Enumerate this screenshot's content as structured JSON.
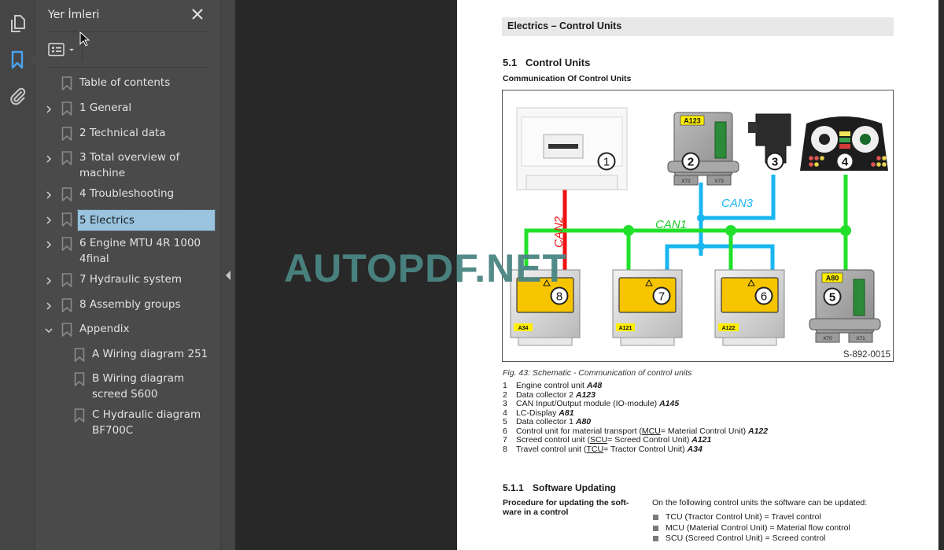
{
  "rail": {
    "icons": [
      "pages-icon",
      "bookmark-icon",
      "attachment-icon"
    ],
    "active_color": "#4aa3f0"
  },
  "panel": {
    "title": "Yer İmleri",
    "options_icon": "list-options-icon",
    "bookmarks": [
      {
        "label": "Table of contents",
        "expandable": false,
        "level": 0
      },
      {
        "label": "1 General",
        "expandable": true,
        "level": 0
      },
      {
        "label": "2 Technical data",
        "expandable": false,
        "level": 0
      },
      {
        "label_lines": [
          "3 Total overview of",
          "machine"
        ],
        "expandable": true,
        "level": 0
      },
      {
        "label": "4 Troubleshooting",
        "expandable": true,
        "level": 0
      },
      {
        "label": "5 Electrics",
        "expandable": true,
        "level": 0,
        "selected": true
      },
      {
        "label_lines": [
          "6 Engine MTU 4R 1000",
          "4final"
        ],
        "expandable": true,
        "level": 0
      },
      {
        "label": "7 Hydraulic system",
        "expandable": true,
        "level": 0
      },
      {
        "label": "8 Assembly groups",
        "expandable": true,
        "level": 0
      },
      {
        "label": "Appendix",
        "expandable": true,
        "expanded": true,
        "level": 0
      },
      {
        "label": "A Wiring diagram 251",
        "expandable": false,
        "level": 1
      },
      {
        "label_lines": [
          "B Wiring diagram",
          "screed S600"
        ],
        "expandable": false,
        "level": 1
      },
      {
        "label_lines": [
          "C Hydraulic diagram",
          "BF700C"
        ],
        "expandable": false,
        "level": 1
      }
    ],
    "selected_color": "#99c3de"
  },
  "watermark": "AUTOPDF.NET",
  "page": {
    "header": "Electrics – Control Units",
    "section": {
      "num": "5.1",
      "title": "Control Units"
    },
    "subheading": "Communication Of Control Units",
    "figure": {
      "code": "S-892-0015",
      "bus_labels": {
        "can1": "CAN1",
        "can2": "CAN2",
        "can3": "CAN3"
      },
      "bus_colors": {
        "can1": "#22e02a",
        "can2": "#ee1111",
        "can3": "#1ab6f0"
      },
      "units": [
        {
          "num": "1",
          "tag": ""
        },
        {
          "num": "2",
          "tag": "A123",
          "ports": [
            "X72",
            "X73"
          ]
        },
        {
          "num": "3",
          "tag": ""
        },
        {
          "num": "4",
          "tag": ""
        },
        {
          "num": "5",
          "tag": "A80",
          "ports": [
            "X70",
            "X71"
          ]
        },
        {
          "num": "6",
          "tag": "A122"
        },
        {
          "num": "7",
          "tag": "A121"
        },
        {
          "num": "8",
          "tag": "A34"
        }
      ]
    },
    "caption": "Fig.  43: Schematic - Communication of control units",
    "legend": [
      {
        "n": "1",
        "pre": "Engine control unit ",
        "abbr": "",
        "post": "",
        "code": "A48"
      },
      {
        "n": "2",
        "pre": "Data collector 2 ",
        "abbr": "",
        "post": "",
        "code": "A123"
      },
      {
        "n": "3",
        "pre": "CAN Input/Output module (IO-module) ",
        "abbr": "",
        "post": "",
        "code": "A145"
      },
      {
        "n": "4",
        "pre": "LC-Display ",
        "abbr": "",
        "post": "",
        "code": "A81"
      },
      {
        "n": "5",
        "pre": "Data collector 1 ",
        "abbr": "",
        "post": "",
        "code": "A80"
      },
      {
        "n": "6",
        "pre": "Control unit for material transport (",
        "abbr": "MCU",
        "post": "= Material Control Unit) ",
        "code": "A122"
      },
      {
        "n": "7",
        "pre": "Screed control unit (",
        "abbr": "SCU",
        "post": "= Screed Control Unit) ",
        "code": "A121"
      },
      {
        "n": "8",
        "pre": "Travel control unit (",
        "abbr": "TCU",
        "post": "= Tractor Control Unit) ",
        "code": "A34"
      }
    ],
    "subsection": {
      "num": "5.1.1",
      "title": "Software Updating"
    },
    "side_label": "Procedure for updating the soft-ware in a control",
    "body": "On the following control units the software can be updated:",
    "bullets": [
      "TCU (Tractor Control Unit) = Travel control",
      "MCU (Material Control Unit) = Material flow control",
      "SCU (Screed Control Unit) = Screed control"
    ]
  }
}
